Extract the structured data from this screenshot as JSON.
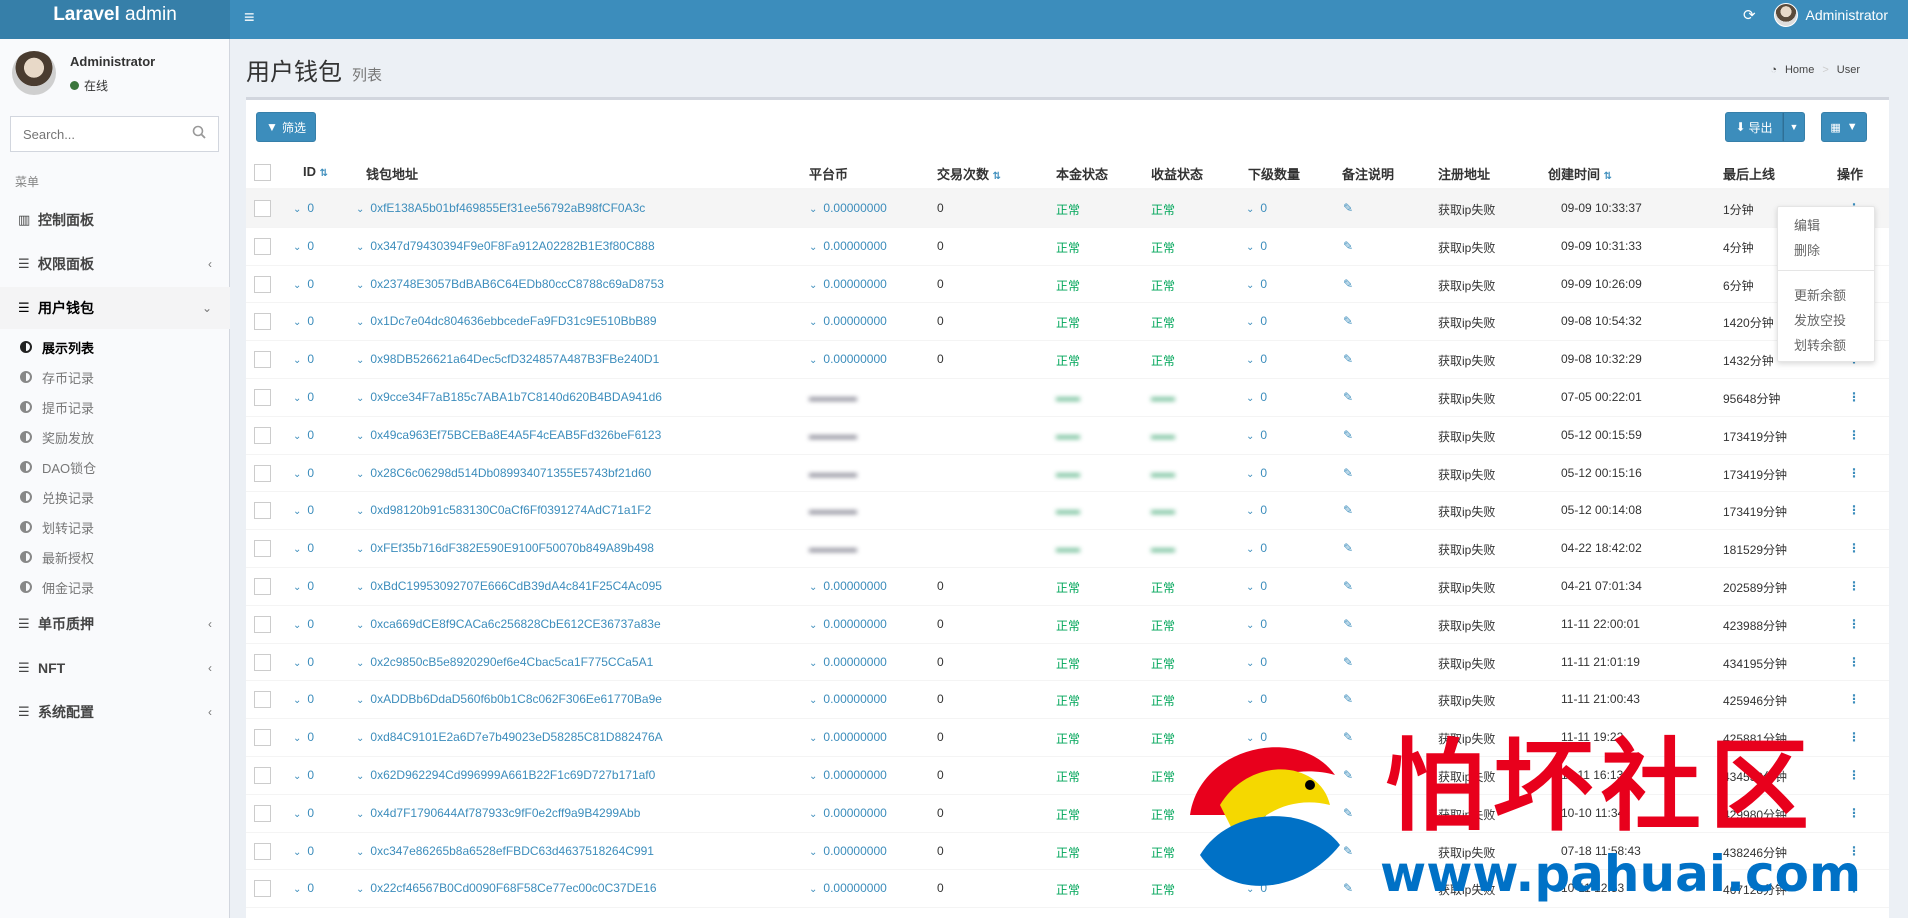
{
  "header": {
    "logo_bold": "Laravel",
    "logo_rest": " admin",
    "user_name": "Administrator"
  },
  "sidebar": {
    "user_name": "Administrator",
    "status": "在线",
    "search_placeholder": "Search...",
    "menu_header": "菜单",
    "items": [
      {
        "label": "控制面板",
        "icon": "chart-icon"
      },
      {
        "label": "权限面板",
        "icon": "list-icon"
      },
      {
        "label": "用户钱包",
        "icon": "list-icon"
      },
      {
        "label": "单币质押",
        "icon": "list-icon"
      },
      {
        "label": "NFT",
        "icon": "list-icon"
      },
      {
        "label": "系统配置",
        "icon": "list-icon"
      }
    ],
    "sub_items": [
      "展示列表",
      "存币记录",
      "提币记录",
      "奖励发放",
      "DAO锁仓",
      "兑换记录",
      "划转记录",
      "最新授权",
      "佣金记录"
    ]
  },
  "page": {
    "title": "用户钱包",
    "subtitle": "列表"
  },
  "breadcrumb": {
    "home": "Home",
    "current": "User"
  },
  "toolbar": {
    "filter": "筛选",
    "export": "导出"
  },
  "columns": {
    "id": "ID",
    "address": "钱包地址",
    "coin": "平台币",
    "trades": "交易次数",
    "principal": "本金状态",
    "income": "收益状态",
    "sub_count": "下级数量",
    "remark": "备注说明",
    "reg_addr": "注册地址",
    "created": "创建时间",
    "last_online": "最后上线",
    "actions": "操作"
  },
  "rows": [
    {
      "id": "0",
      "address": "0xfE138A5b01bf469855Ef31ee56792aB98fCF0A3c",
      "coin": "0.00000000",
      "trades": "0",
      "principal": "正常",
      "income": "正常",
      "sub": "0",
      "reg": "获取ip失败",
      "created": "09-09 10:33:37",
      "last": "1分钟"
    },
    {
      "id": "0",
      "address": "0x347d79430394F9e0F8Fa912A02282B1E3f80C888",
      "coin": "0.00000000",
      "trades": "0",
      "principal": "正常",
      "income": "正常",
      "sub": "0",
      "reg": "获取ip失败",
      "created": "09-09 10:31:33",
      "last": "4分钟"
    },
    {
      "id": "0",
      "address": "0x23748E3057BdBAB6C64EDb80ccC8788c69aD8753",
      "coin": "0.00000000",
      "trades": "0",
      "principal": "正常",
      "income": "正常",
      "sub": "0",
      "reg": "获取ip失败",
      "created": "09-09 10:26:09",
      "last": "6分钟"
    },
    {
      "id": "0",
      "address": "0x1Dc7e04dc804636ebbcedeFa9FD31c9E510BbB89",
      "coin": "0.00000000",
      "trades": "0",
      "principal": "正常",
      "income": "正常",
      "sub": "0",
      "reg": "获取ip失败",
      "created": "09-08 10:54:32",
      "last": "1420分钟"
    },
    {
      "id": "0",
      "address": "0x98DB526621a64Dec5cfD324857A487B3FBe240D1",
      "coin": "0.00000000",
      "trades": "0",
      "principal": "正常",
      "income": "正常",
      "sub": "0",
      "reg": "获取ip失败",
      "created": "09-08 10:32:29",
      "last": "1432分钟"
    },
    {
      "id": "0",
      "address": "0x9cce34F7aB185c7ABA1b7C8140d620B4BDA941d6",
      "coin": "",
      "trades": "",
      "principal": "",
      "income": "",
      "sub": "0",
      "reg": "获取ip失败",
      "created": "07-05 00:22:01",
      "last": "95648分钟"
    },
    {
      "id": "0",
      "address": "0x49ca963Ef75BCEBa8E4A5F4cEAB5Fd326beF6123",
      "coin": "",
      "trades": "",
      "principal": "",
      "income": "",
      "sub": "0",
      "reg": "获取ip失败",
      "created": "05-12 00:15:59",
      "last": "173419分钟"
    },
    {
      "id": "0",
      "address": "0x28C6c06298d514Db089934071355E5743bf21d60",
      "coin": "",
      "trades": "",
      "principal": "",
      "income": "",
      "sub": "0",
      "reg": "获取ip失败",
      "created": "05-12 00:15:16",
      "last": "173419分钟"
    },
    {
      "id": "0",
      "address": "0xd98120b91c583130C0aCf6Ff0391274AdC71a1F2",
      "coin": "",
      "trades": "",
      "principal": "",
      "income": "",
      "sub": "0",
      "reg": "获取ip失败",
      "created": "05-12 00:14:08",
      "last": "173419分钟"
    },
    {
      "id": "0",
      "address": "0xFEf35b716dF382E590E9100F50070b849A89b498",
      "coin": "",
      "trades": "",
      "principal": "",
      "income": "",
      "sub": "0",
      "reg": "获取ip失败",
      "created": "04-22 18:42:02",
      "last": "181529分钟"
    },
    {
      "id": "0",
      "address": "0xBdC19953092707E666CdB39dA4c841F25C4Ac095",
      "coin": "0.00000000",
      "trades": "0",
      "principal": "正常",
      "income": "正常",
      "sub": "0",
      "reg": "获取ip失败",
      "created": "04-21 07:01:34",
      "last": "202589分钟"
    },
    {
      "id": "0",
      "address": "0xca669dCE8f9CACa6c256828CbE612CE36737a83e",
      "coin": "0.00000000",
      "trades": "0",
      "principal": "正常",
      "income": "正常",
      "sub": "0",
      "reg": "获取ip失败",
      "created": "11-11 22:00:01",
      "last": "423988分钟"
    },
    {
      "id": "0",
      "address": "0x2c9850cB5e8920290ef6e4Cbac5ca1F775CCa5A1",
      "coin": "0.00000000",
      "trades": "0",
      "principal": "正常",
      "income": "正常",
      "sub": "0",
      "reg": "获取ip失败",
      "created": "11-11 21:01:19",
      "last": "434195分钟"
    },
    {
      "id": "0",
      "address": "0xADDBb6DdaD560f6b0b1C8c062F306Ee61770Ba9e",
      "coin": "0.00000000",
      "trades": "0",
      "principal": "正常",
      "income": "正常",
      "sub": "0",
      "reg": "获取ip失败",
      "created": "11-11 21:00:43",
      "last": "425946分钟"
    },
    {
      "id": "0",
      "address": "0xd84C9101E2a6D7e7b49023eD58285C81D882476A",
      "coin": "0.00000000",
      "trades": "0",
      "principal": "正常",
      "income": "正常",
      "sub": "0",
      "reg": "获取ip失败",
      "created": "11-11 19:22",
      "last": "425881分钟"
    },
    {
      "id": "0",
      "address": "0x62D962294Cd996999A661B22F1c69D727b171af0",
      "coin": "0.00000000",
      "trades": "0",
      "principal": "正常",
      "income": "正常",
      "sub": "0",
      "reg": "获取ip失败",
      "created": "11-11 16:13",
      "last": "434539分钟"
    },
    {
      "id": "0",
      "address": "0x4d7F1790644Af787933c9fF0e2cff9a9B4299Abb",
      "coin": "0.00000000",
      "trades": "0",
      "principal": "正常",
      "income": "正常",
      "sub": "0",
      "reg": "获取ip失败",
      "created": "10-10 11:34",
      "last": "429980分钟"
    },
    {
      "id": "0",
      "address": "0xc347e86265b8a6528efFBDC63d4637518264C991",
      "coin": "0.00000000",
      "trades": "0",
      "principal": "正常",
      "income": "正常",
      "sub": "0",
      "reg": "获取ip失败",
      "created": "07-18 11:58:43",
      "last": "438246分钟"
    },
    {
      "id": "0",
      "address": "0x22cf46567B0Cd0090F68F58Ce77ec00c0C37DE16",
      "coin": "0.00000000",
      "trades": "0",
      "principal": "正常",
      "income": "正常",
      "sub": "0",
      "reg": "获取ip失败",
      "created": "10-11 12:53",
      "last": "467128分钟"
    }
  ],
  "dropdown": [
    "编辑",
    "删除",
    "更新余额",
    "发放空投",
    "划转余额"
  ],
  "watermark": {
    "text": "怕坏社区",
    "url": "www.pahuai.com"
  }
}
